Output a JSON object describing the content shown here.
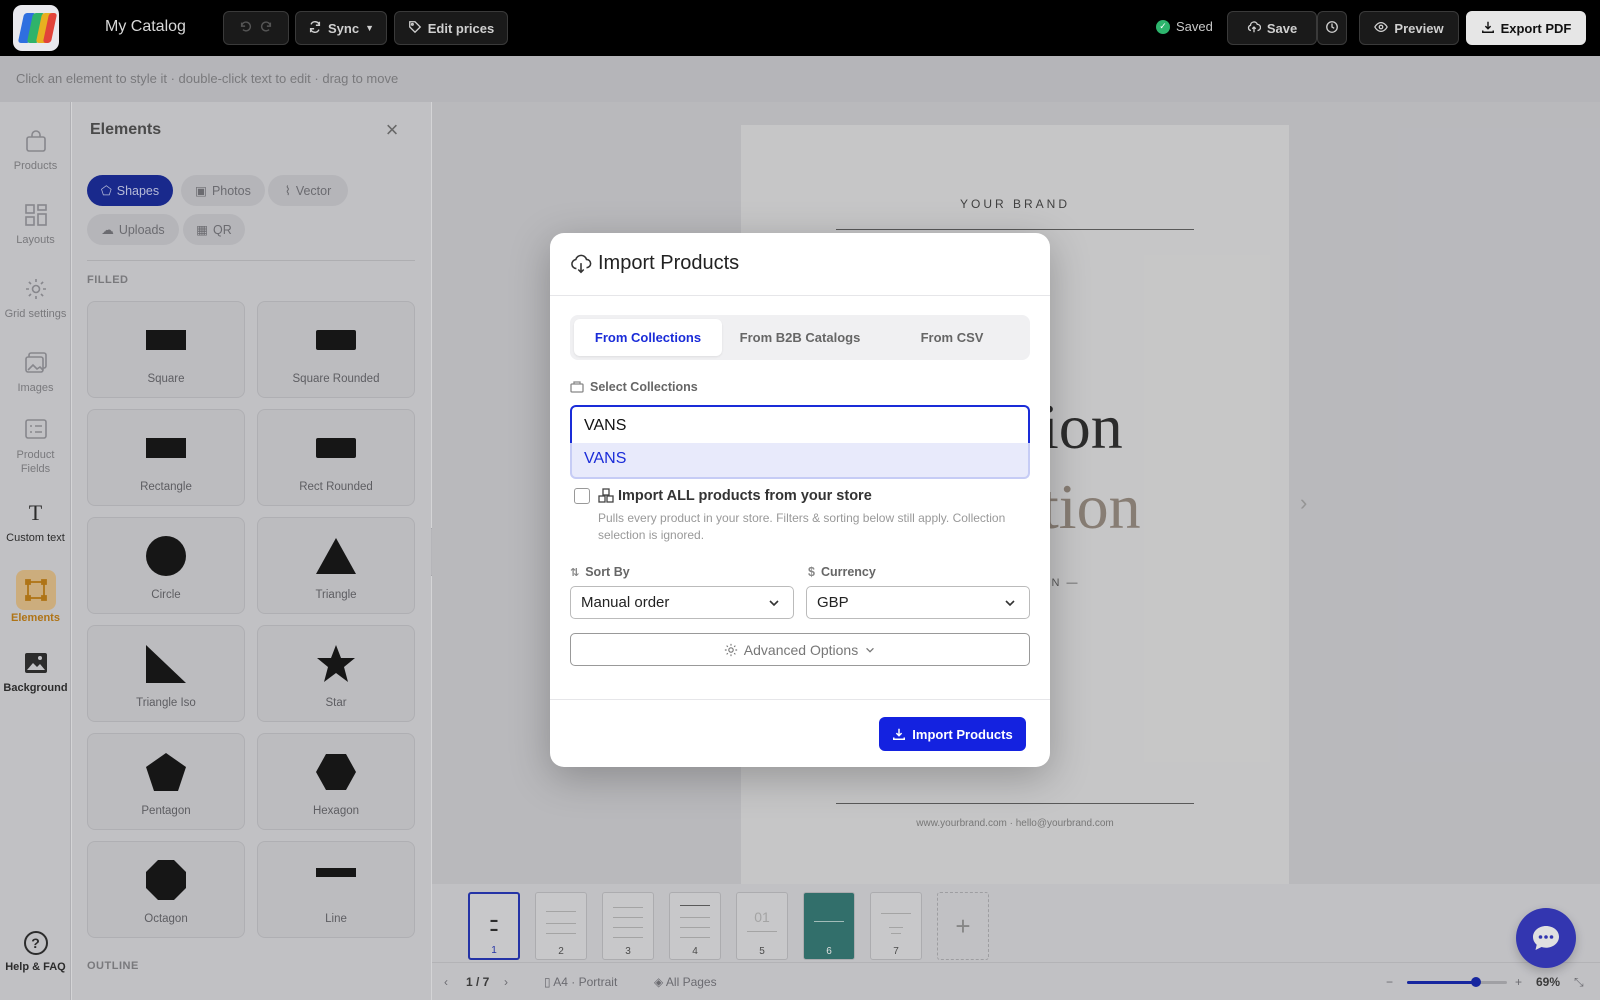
{
  "topbar": {
    "app_title": "My Catalog",
    "sync_label": "Sync",
    "edit_prices_label": "Edit prices",
    "saved_label": "Saved",
    "save_label": "Save",
    "preview_label": "Preview",
    "export_label": "Export PDF"
  },
  "hint": "Click an element to style it · double-click text to edit · drag to move",
  "rail": {
    "items": [
      {
        "label": "Products",
        "icon": "bag-icon"
      },
      {
        "label": "Layouts",
        "icon": "layout-grid-icon"
      },
      {
        "label": "Grid settings",
        "icon": "gear-icon"
      },
      {
        "label": "Images",
        "icon": "images-icon"
      },
      {
        "label": "Product Fields",
        "icon": "fields-icon"
      },
      {
        "label": "Custom text",
        "icon": "text-icon"
      },
      {
        "label": "Elements",
        "icon": "shapes-icon"
      },
      {
        "label": "Background",
        "icon": "background-icon"
      }
    ],
    "help_label": "Help & FAQ"
  },
  "panel": {
    "title": "Elements",
    "chips": [
      {
        "label": "Shapes"
      },
      {
        "label": "Photos"
      },
      {
        "label": "Vector"
      },
      {
        "label": "Uploads"
      },
      {
        "label": "QR"
      }
    ],
    "filled_label": "FILLED",
    "outline_label": "OUTLINE",
    "shapes": [
      {
        "label": "Square"
      },
      {
        "label": "Square Rounded"
      },
      {
        "label": "Rectangle"
      },
      {
        "label": "Rect Rounded"
      },
      {
        "label": "Circle"
      },
      {
        "label": "Triangle"
      },
      {
        "label": "Triangle Iso"
      },
      {
        "label": "Star"
      },
      {
        "label": "Pentagon"
      },
      {
        "label": "Hexagon"
      },
      {
        "label": "Octagon"
      },
      {
        "label": "Line"
      }
    ]
  },
  "canvas": {
    "brand": "YOUR BRAND",
    "big_line_1": "ion",
    "big_line_2": "tion",
    "subline": "ON —",
    "footer": "www.yourbrand.com · hello@yourbrand.com"
  },
  "thumbnails": [
    "1",
    "2",
    "3",
    "4",
    "5",
    "6",
    "7"
  ],
  "statusbar": {
    "page_indicator": "1 / 7",
    "page_size": "A4 · Portrait",
    "pages_scope": "All Pages",
    "zoom": "69%",
    "zoom_fraction": 0.69,
    "zoom_minus": "−",
    "zoom_plus": "+"
  },
  "modal": {
    "title": "Import Products",
    "tabs": [
      {
        "label": "From Collections",
        "active": true
      },
      {
        "label": "From B2B Catalogs",
        "active": false
      },
      {
        "label": "From CSV",
        "active": false
      }
    ],
    "collections_label": "Select Collections",
    "search_value": "VANS",
    "dropdown_option": "VANS",
    "import_all_label": "Import ALL products from your store",
    "import_all_desc": "Pulls every product in your store. Filters & sorting below still apply. Collection selection is ignored.",
    "sort_label": "Sort By",
    "sort_value": "Manual order",
    "currency_label": "Currency",
    "currency_value": "GBP",
    "advanced_label": "Advanced Options",
    "import_button": "Import Products"
  },
  "colors": {
    "accent": "#1a2cd8",
    "topbar_bg": "#000000",
    "saved_green": "#2db56d",
    "elements_active": "#c8841a"
  }
}
